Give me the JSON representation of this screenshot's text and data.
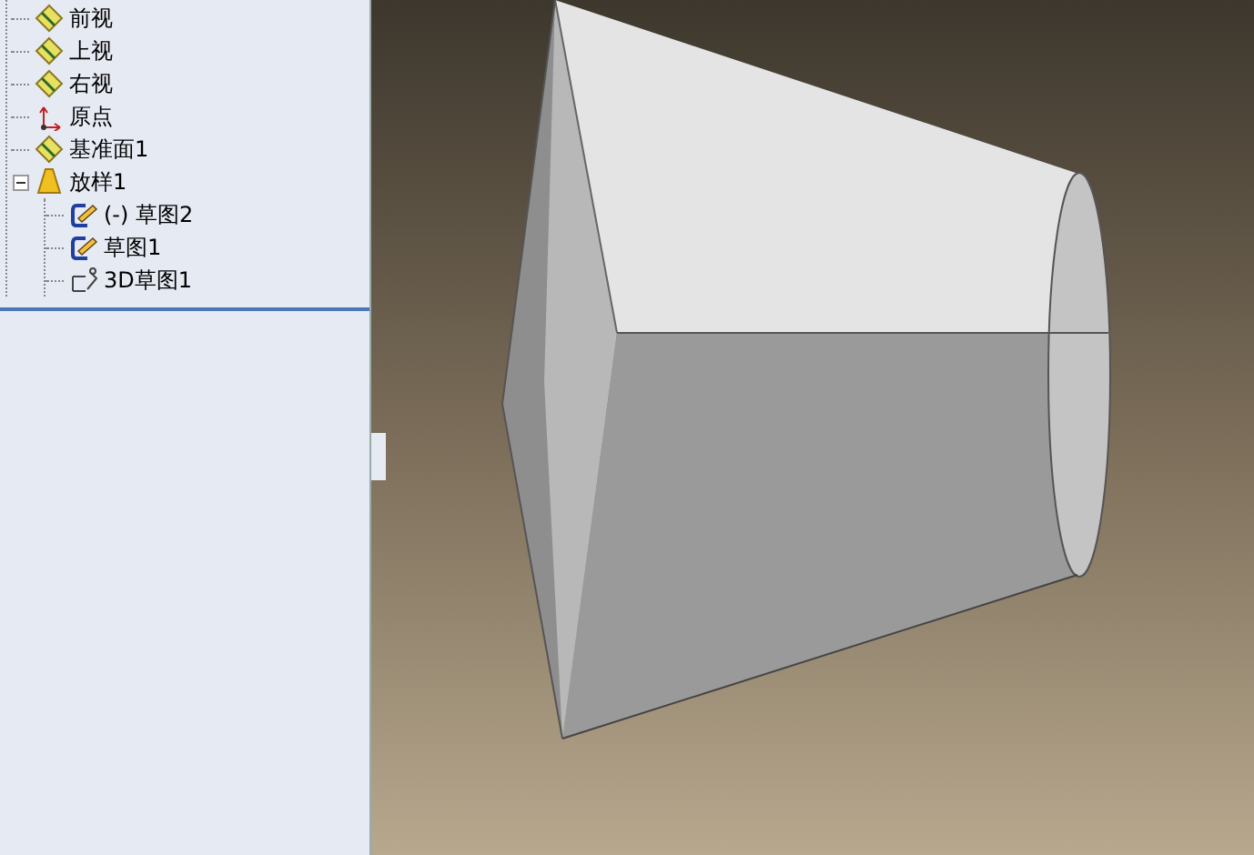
{
  "feature_tree": [
    {
      "kind": "plane",
      "label": "前视"
    },
    {
      "kind": "plane",
      "label": "上视"
    },
    {
      "kind": "plane",
      "label": "右视"
    },
    {
      "kind": "origin",
      "label": "原点"
    },
    {
      "kind": "plane",
      "label": "基准面1"
    },
    {
      "kind": "loft",
      "label": "放样1",
      "expanded": true,
      "children": [
        {
          "kind": "sketch",
          "label": "(-) 草图2"
        },
        {
          "kind": "sketch",
          "label": "草图1"
        },
        {
          "kind": "sketch3d",
          "label": "3D草图1"
        }
      ]
    }
  ]
}
